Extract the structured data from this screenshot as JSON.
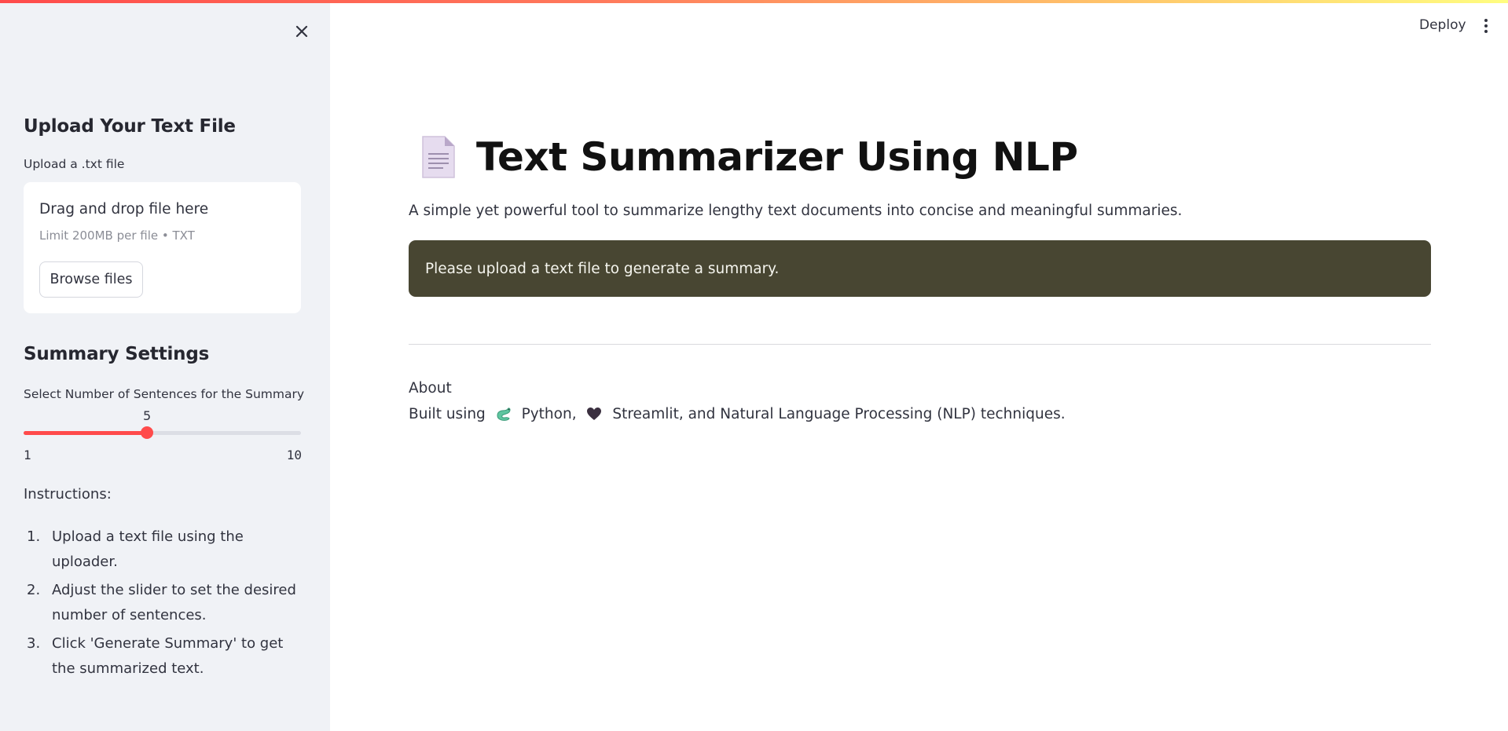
{
  "header": {
    "deploy_label": "Deploy"
  },
  "sidebar": {
    "upload_heading": "Upload Your Text File",
    "upload_label": "Upload a .txt file",
    "uploader": {
      "drag_text": "Drag and drop file here",
      "limit_text": "Limit 200MB per file • TXT",
      "browse_label": "Browse files"
    },
    "settings_heading": "Summary Settings",
    "slider": {
      "label": "Select Number of Sentences for the Summary",
      "value": 5,
      "min": 1,
      "max": 10,
      "value_text": "5",
      "min_text": "1",
      "max_text": "10"
    },
    "instructions_title": "Instructions:",
    "instructions": [
      {
        "num": "1.",
        "text": "Upload a text file using the uploader."
      },
      {
        "num": "2.",
        "text": "Adjust the slider to set the desired number of sentences."
      },
      {
        "num": "3.",
        "text": "Click 'Generate Summary' to get the summarized text."
      }
    ]
  },
  "main": {
    "title": "Text Summarizer Using NLP",
    "subtitle": "A simple yet powerful tool to summarize lengthy text documents into concise and meaningful summaries.",
    "info_message": "Please upload a text file to generate a summary.",
    "about_title": "About",
    "about": {
      "prefix": "Built using ",
      "python": " Python, ",
      "streamlit": " Streamlit, and Natural Language Processing (NLP) techniques."
    }
  },
  "colors": {
    "accent": "#ff4b4b",
    "sidebar_bg": "#f0f2f6",
    "info_bg": "#484632"
  },
  "icons": {
    "close": "close-icon",
    "menu": "kebab-menu-icon",
    "title": "page-facing-up-icon",
    "python": "snake-icon",
    "streamlit": "black-heart-icon"
  }
}
